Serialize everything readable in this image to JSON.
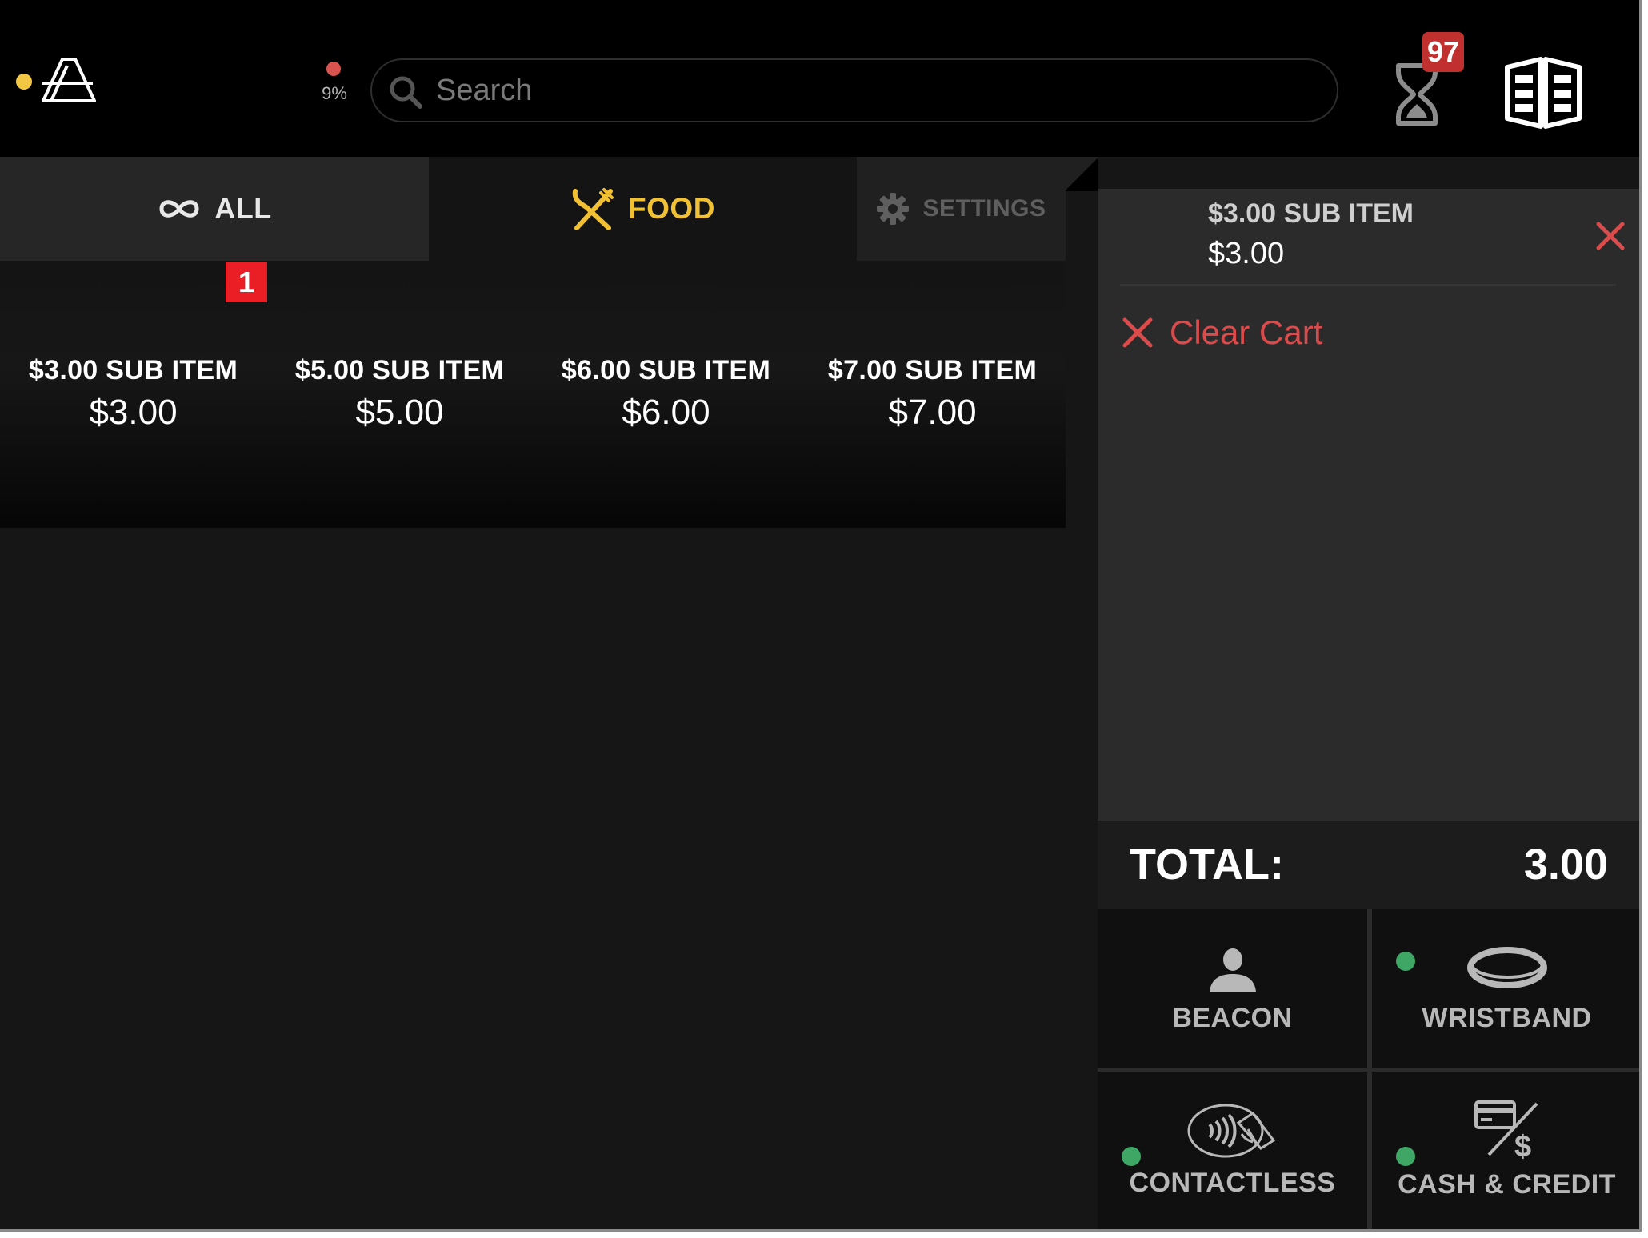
{
  "header": {
    "battery_percent": "9%",
    "queue_count": "97",
    "colors": {
      "status_dot": "#f2c744",
      "battery_dot": "#d9534f",
      "badge": "#c0302e"
    }
  },
  "search": {
    "placeholder": "Search",
    "value": ""
  },
  "tabs": [
    {
      "label": "ALL",
      "icon": "infinity-icon",
      "selected": false
    },
    {
      "label": "FOOD",
      "icon": "utensils-icon",
      "selected": true,
      "color": "#f1c033"
    },
    {
      "label": "SETTINGS",
      "icon": "gear-icon",
      "selected": false
    }
  ],
  "products": {
    "cart_count_badge": "1",
    "items": [
      {
        "name": "$3.00 SUB ITEM",
        "price": "$3.00"
      },
      {
        "name": "$5.00 SUB ITEM",
        "price": "$5.00"
      },
      {
        "name": "$6.00 SUB ITEM",
        "price": "$6.00"
      },
      {
        "name": "$7.00 SUB ITEM",
        "price": "$7.00"
      }
    ]
  },
  "cart": {
    "items": [
      {
        "name": "$3.00 SUB ITEM",
        "price": "$3.00"
      }
    ],
    "clear_label": "Clear Cart",
    "total_label": "TOTAL:",
    "total_value": "3.00",
    "accent_color": "#dc4b4b"
  },
  "payment_methods": [
    {
      "label": "BEACON",
      "icon": "person-icon",
      "available": false
    },
    {
      "label": "WRISTBAND",
      "icon": "wristband-icon",
      "available": true
    },
    {
      "label": "CONTACTLESS",
      "icon": "contactless-icon",
      "available": true
    },
    {
      "label": "CASH & CREDIT",
      "icon": "cash-credit-icon",
      "available": true
    }
  ]
}
